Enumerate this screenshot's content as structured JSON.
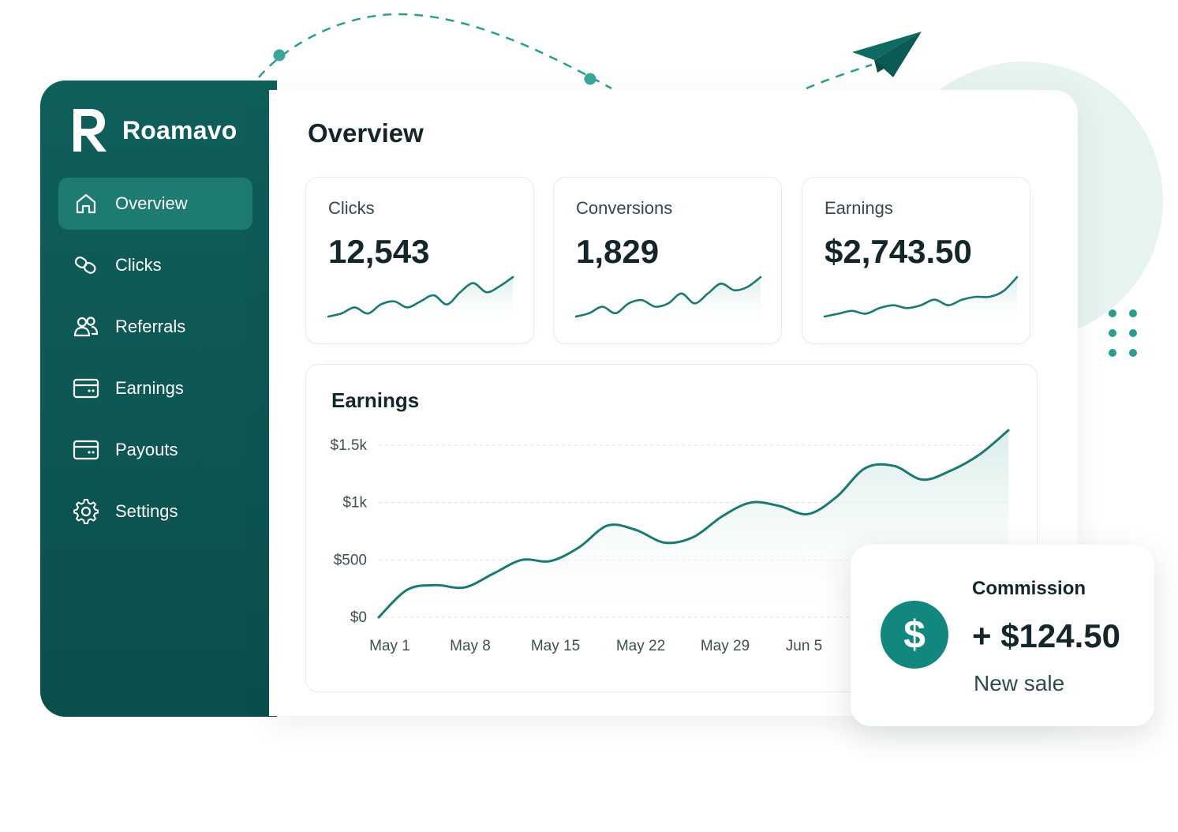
{
  "brand": {
    "name": "Roamavo",
    "logo_letter": "R"
  },
  "sidebar": {
    "items": [
      {
        "label": "Overview",
        "icon": "home-icon",
        "active": true
      },
      {
        "label": "Clicks",
        "icon": "link-icon",
        "active": false
      },
      {
        "label": "Referrals",
        "icon": "users-icon",
        "active": false
      },
      {
        "label": "Earnings",
        "icon": "wallet-icon",
        "active": false
      },
      {
        "label": "Payouts",
        "icon": "card-icon",
        "active": false
      },
      {
        "label": "Settings",
        "icon": "gear-icon",
        "active": false
      }
    ]
  },
  "main": {
    "title": "Overview",
    "stats": [
      {
        "label": "Clicks",
        "value": "12,543"
      },
      {
        "label": "Conversions",
        "value": "1,829"
      },
      {
        "label": "Earnings",
        "value": "$2,743.50"
      }
    ]
  },
  "colors": {
    "brand_dark": "#0b4f4d",
    "brand": "#0f5f5b",
    "accent": "#1a7a72",
    "active_nav": "#1e7b72",
    "line": "#1a7a72",
    "fill": "#d8ece9"
  },
  "chart_data": {
    "type": "area",
    "title": "Earnings",
    "x_labels": [
      "May 1",
      "May 8",
      "May 15",
      "May 22",
      "May 29",
      "Jun 5"
    ],
    "y_ticks": [
      {
        "label": "$0",
        "value": 0
      },
      {
        "label": "$500",
        "value": 500
      },
      {
        "label": "$1k",
        "value": 1000
      },
      {
        "label": "$1.5k",
        "value": 1500
      }
    ],
    "ylim": [
      0,
      1500
    ],
    "series": [
      {
        "values": [
          0,
          240,
          280,
          260,
          380,
          500,
          490,
          610,
          800,
          760,
          650,
          700,
          880,
          1000,
          970,
          900,
          1050,
          1300,
          1320,
          1200,
          1280,
          1420,
          1630
        ]
      }
    ],
    "grid": true,
    "legend": "none"
  },
  "sparklines": [
    {
      "values": [
        2,
        3,
        5,
        3,
        6,
        7,
        5,
        7,
        9,
        6,
        10,
        13,
        10,
        12,
        15
      ]
    },
    {
      "values": [
        2,
        3,
        5,
        3,
        6,
        7,
        5,
        6,
        9,
        6,
        9,
        12,
        10,
        11,
        14
      ]
    },
    {
      "values": [
        2,
        3,
        4,
        3,
        5,
        6,
        5,
        6,
        8,
        6,
        8,
        9,
        9,
        11,
        16
      ]
    }
  ],
  "toast": {
    "title": "Commission",
    "amount": "+ $124.50",
    "subtitle": "New sale",
    "icon": "dollar-icon",
    "icon_glyph": "$"
  }
}
